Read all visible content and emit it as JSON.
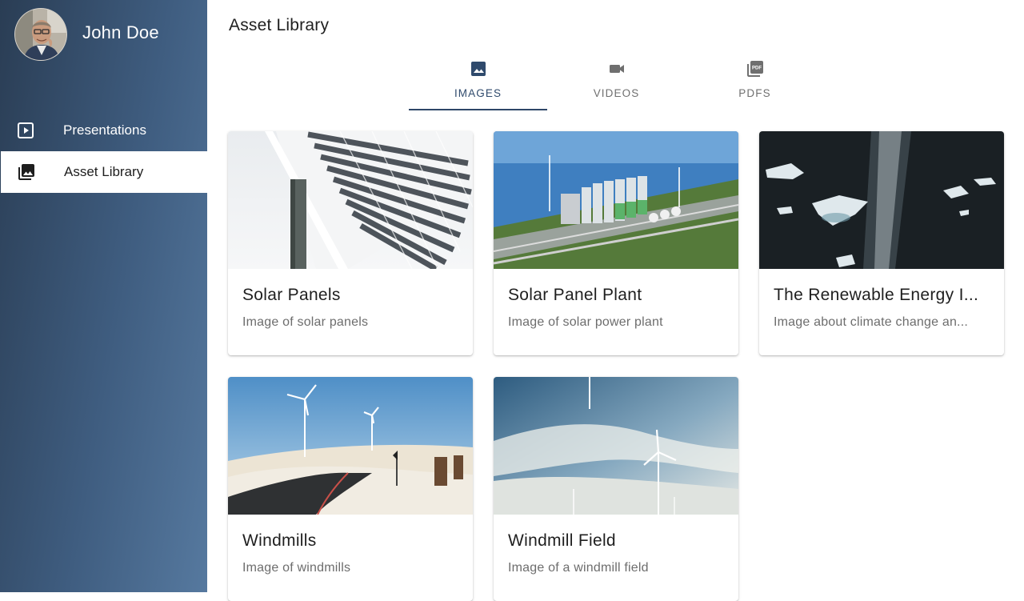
{
  "user": {
    "name": "John Doe"
  },
  "sidebar": {
    "items": [
      {
        "label": "Presentations",
        "icon": "slideshow-icon",
        "active": false
      },
      {
        "label": "Asset Library",
        "icon": "photo-library-icon",
        "active": true
      }
    ]
  },
  "main": {
    "title": "Asset Library",
    "tabs": [
      {
        "label": "IMAGES",
        "icon": "image-icon",
        "active": true
      },
      {
        "label": "VIDEOS",
        "icon": "videocam-icon",
        "active": false
      },
      {
        "label": "PDFS",
        "icon": "pdf-icon",
        "active": false
      }
    ],
    "cards": [
      {
        "title": "Solar Panels",
        "description": "Image of solar panels"
      },
      {
        "title": "Solar Panel Plant",
        "description": "Image of solar power plant"
      },
      {
        "title": "The Renewable Energy I...",
        "description": "Image about climate change an..."
      },
      {
        "title": "Windmills",
        "description": "Image of windmills"
      },
      {
        "title": "Windmill Field",
        "description": "Image of a windmill field"
      }
    ]
  },
  "colors": {
    "sidebar_gradient_start": "#2a3d54",
    "sidebar_gradient_end": "#56799f",
    "tab_active": "#2e4668",
    "tab_inactive_text": "#6f6f6f"
  }
}
